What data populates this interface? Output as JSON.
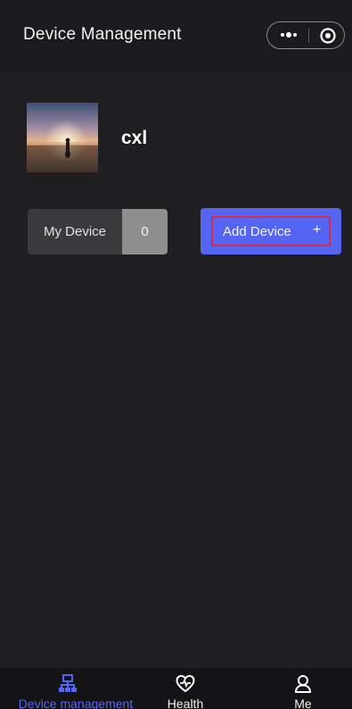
{
  "header": {
    "title": "Device Management",
    "more_icon": "more-dots-icon",
    "target_icon": "target-icon"
  },
  "profile": {
    "username": "cxl",
    "avatar_icon": "sunset-photo-avatar"
  },
  "actions": {
    "my_device_label": "My Device",
    "my_device_count": "0",
    "add_device_label": "Add Device",
    "add_device_plus": "+"
  },
  "tabbar": {
    "items": [
      {
        "label": "Device management",
        "icon": "device-network-icon",
        "active": true
      },
      {
        "label": "Health",
        "icon": "heart-pulse-icon",
        "active": false
      },
      {
        "label": "Me",
        "icon": "person-icon",
        "active": false
      }
    ]
  },
  "colors": {
    "background": "#1f1f22",
    "accent": "#5565f3",
    "highlight_border": "#d6284d",
    "count_badge": "#8e8e8e"
  }
}
